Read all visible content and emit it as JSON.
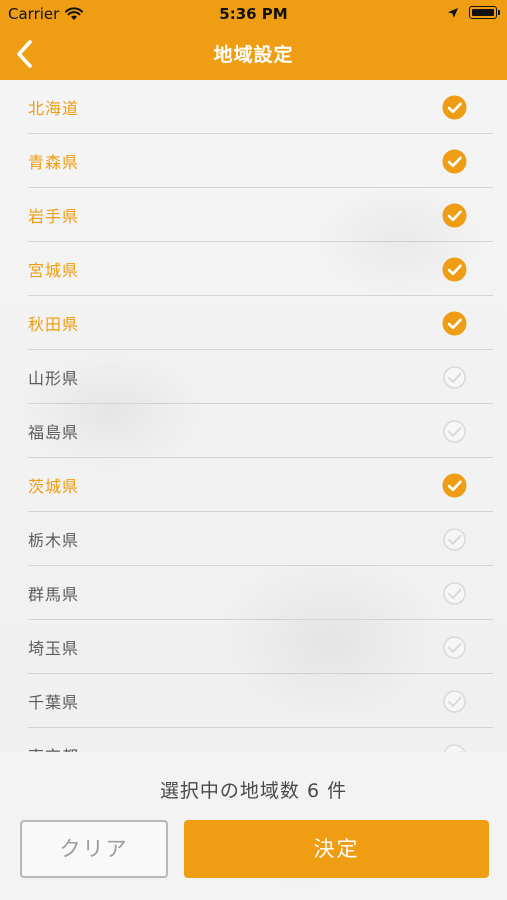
{
  "status_bar": {
    "carrier": "Carrier",
    "time": "5:36 PM",
    "icons": [
      "wifi-icon",
      "location-arrow-icon",
      "battery-icon"
    ]
  },
  "nav": {
    "title": "地域設定",
    "back_icon": "chevron-left-icon"
  },
  "colors": {
    "accent": "#ef9d12",
    "selected_text": "#ef9d12",
    "unselected_text": "#5c5c5c",
    "unchecked_icon": "#d9d9d9"
  },
  "regions": [
    {
      "label": "北海道",
      "selected": true
    },
    {
      "label": "青森県",
      "selected": true
    },
    {
      "label": "岩手県",
      "selected": true
    },
    {
      "label": "宮城県",
      "selected": true
    },
    {
      "label": "秋田県",
      "selected": true
    },
    {
      "label": "山形県",
      "selected": false
    },
    {
      "label": "福島県",
      "selected": false
    },
    {
      "label": "茨城県",
      "selected": true
    },
    {
      "label": "栃木県",
      "selected": false
    },
    {
      "label": "群馬県",
      "selected": false
    },
    {
      "label": "埼玉県",
      "selected": false
    },
    {
      "label": "千葉県",
      "selected": false
    },
    {
      "label": "東京都",
      "selected": false
    }
  ],
  "footer": {
    "count_text": "選択中の地域数 6 件",
    "clear_label": "クリア",
    "ok_label": "決定"
  }
}
